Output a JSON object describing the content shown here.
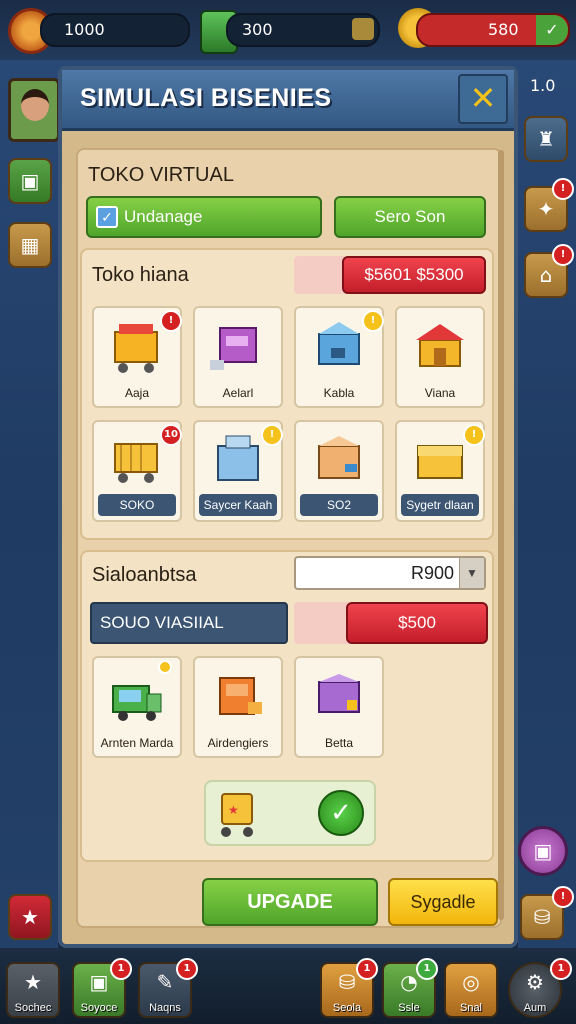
{
  "top_bar": {
    "coins": "1000",
    "gems": "300",
    "cash": "580",
    "level": "1.0"
  },
  "modal": {
    "title": "SIMULASI BISENIES",
    "close_label": "✕"
  },
  "store": {
    "title": "TOKO VIRTUAL",
    "btn_left": "Undanage",
    "btn_right": "Sero Son",
    "subtitle": "Toko hiana",
    "price_tag": "$5601 $5300",
    "items": [
      {
        "label": "Aaja",
        "icon": "shopping-cart-icon",
        "badge": "!"
      },
      {
        "label": "Aelarl",
        "icon": "purple-kiosk-icon",
        "badge": ""
      },
      {
        "label": "Kabla",
        "icon": "blue-shop-icon",
        "badge": "!"
      },
      {
        "label": "Viana",
        "icon": "market-stall-icon",
        "badge": ""
      },
      {
        "label": "SOKO",
        "icon": "cart-icon",
        "badge": "10"
      },
      {
        "label": "Saycer Kaah",
        "icon": "blue-machine-icon",
        "badge": "!"
      },
      {
        "label": "SO2",
        "icon": "orange-shop-icon",
        "badge": ""
      },
      {
        "label": "Sygetr dlaan",
        "icon": "yellow-shop-icon",
        "badge": "!"
      }
    ]
  },
  "section2": {
    "title": "Sialoanbtsa",
    "input_value": "R900",
    "label": "SOUO VIASIIAL",
    "price": "$500",
    "items": [
      {
        "label": "Arnten Marda",
        "icon": "green-truck-icon"
      },
      {
        "label": "Airdengiers",
        "icon": "orange-kiosk-icon"
      },
      {
        "label": "Betta",
        "icon": "purple-shop-icon"
      }
    ]
  },
  "footer_buttons": {
    "upgrade": "UPGADE",
    "secondary": "Sygadle"
  },
  "bottom_nav": [
    {
      "label": "Sochec",
      "badge": ""
    },
    {
      "label": "Soyoce",
      "badge": "1"
    },
    {
      "label": "Naqns",
      "badge": "1"
    },
    {
      "label": "Seola",
      "badge": "1"
    },
    {
      "label": "Ssle",
      "badge": "1"
    },
    {
      "label": "Snal",
      "badge": ""
    },
    {
      "label": "Aum",
      "badge": "1"
    }
  ],
  "colors": {
    "accent_green": "#4fa52a",
    "accent_red": "#c41e2a",
    "accent_yellow": "#f2b60c",
    "header_blue": "#335883"
  }
}
